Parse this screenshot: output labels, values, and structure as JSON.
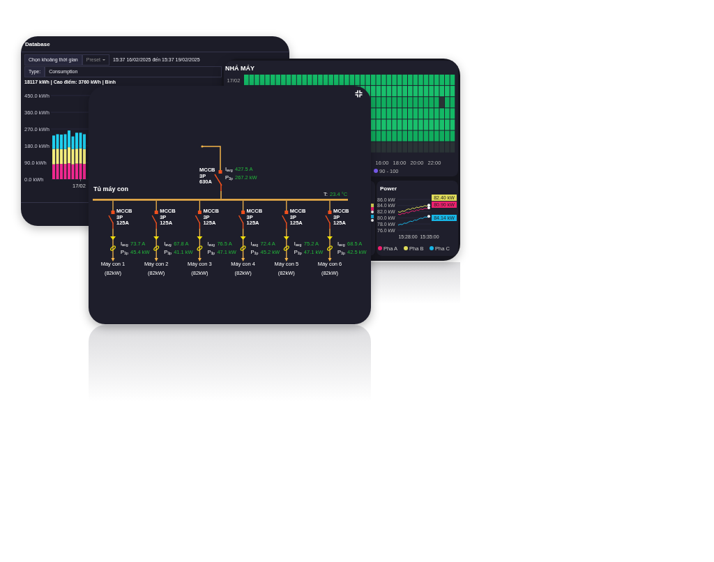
{
  "database": {
    "title": "Database",
    "range_label": "Chọn khoảng thời gian",
    "preset": "Preset",
    "range": "15:37 16/02/2025 đến 15:37 19/02/2025",
    "type_label": "Type:",
    "type_value": "Consumption",
    "summary": "18117 kWh | Cao điểm: 3760 kWh | Bình",
    "date_label": "17/02",
    "chart_data": {
      "type": "bar",
      "stacked": true,
      "grid": true,
      "ylim": [
        0,
        450
      ],
      "yticks": [
        {
          "value": 450,
          "label": "450.0 kWh"
        },
        {
          "value": 360,
          "label": "360.0 kWh"
        },
        {
          "value": 270,
          "label": "270.0 kWh"
        },
        {
          "value": 180,
          "label": "180.0 kWh"
        },
        {
          "value": 90,
          "label": "90.0 kWh"
        },
        {
          "value": 0,
          "label": "0.0 kWh"
        }
      ],
      "series": [
        {
          "color": "#f0288f",
          "values": [
            80,
            82,
            82,
            82,
            86,
            80,
            84,
            84,
            82
          ]
        },
        {
          "color": "#f2ec7c",
          "values": [
            83,
            82,
            80,
            80,
            86,
            82,
            80,
            82,
            80
          ]
        },
        {
          "color": "#1fd0ef",
          "values": [
            72,
            78,
            78,
            80,
            90,
            68,
            86,
            84,
            80
          ]
        }
      ]
    }
  },
  "factory": {
    "title": "NHÁ MÁY",
    "row_label": "17/02",
    "xlabels": [
      "16:00",
      "18:00",
      "20:00",
      "22:00"
    ],
    "legend": [
      {
        "label": "90 - 100",
        "color": "#7a5cf0"
      }
    ]
  },
  "power": {
    "title": "Power",
    "x_labels": [
      "15:28:00",
      "15:35:00"
    ],
    "value_tags": [
      {
        "text": "82.40 kW",
        "color": "#e0dc5a"
      },
      {
        "text": "80.90 kW",
        "color": "#f0206f"
      },
      {
        "text": "84.14 kW",
        "color": "#18b6e6"
      }
    ],
    "chart_data": {
      "type": "line",
      "grid": true,
      "legend": "bottom",
      "ylim": [
        76,
        86
      ],
      "yticks": [
        {
          "value": 86,
          "label": "86.0 kW"
        },
        {
          "value": 84,
          "label": "84.0 kW"
        },
        {
          "value": 82,
          "label": "82.0 kW"
        },
        {
          "value": 80,
          "label": "80.0 kW"
        },
        {
          "value": 78,
          "label": "78.0 kW"
        },
        {
          "value": 76,
          "label": "76.0 kW"
        }
      ],
      "series": [
        {
          "name": "Pha A",
          "color": "#f0206f",
          "values": [
            81.2,
            81.0,
            81.5,
            81.3,
            81.8,
            81.6,
            82.0,
            82.3,
            82.1,
            82.6,
            82.4,
            82.9,
            82.7,
            83.1,
            83.0,
            83.3
          ]
        },
        {
          "name": "Pha B",
          "color": "#e0dc5a",
          "values": [
            82.0,
            81.8,
            82.3,
            82.1,
            82.6,
            82.9,
            82.7,
            83.2,
            83.0,
            83.5,
            83.3,
            83.7,
            83.6,
            84.0,
            83.8,
            84.1
          ]
        },
        {
          "name": "Pha C",
          "color": "#18b6e6",
          "values": [
            77.6,
            77.9,
            77.8,
            78.3,
            78.2,
            78.6,
            78.9,
            78.8,
            79.3,
            79.2,
            79.6,
            79.9,
            79.8,
            80.3,
            80.2,
            80.5
          ]
        }
      ]
    }
  },
  "diagram": {
    "title": "Tủ máy con",
    "temperature_label": "T:",
    "temperature": "23.4 °C",
    "main": {
      "breaker": "MCCB\n3P\n630A",
      "current_label": "I$_{avg}$",
      "current": "427.5 A",
      "power_label": "P$_{3p}$",
      "power": "267.2 kW"
    },
    "feeders": [
      {
        "breaker": "MCCB\n3P\n125A",
        "current_label": "I$_{avg}$",
        "current": "73.7 A",
        "power_label": "P$_{3p}$",
        "power": "45.4 kW",
        "name": "Máy con 1",
        "rating": "(82kW)"
      },
      {
        "breaker": "MCCB\n3P\n125A",
        "current_label": "I$_{avg}$",
        "current": "67.8 A",
        "power_label": "P$_{3p}$",
        "power": "41.1 kW",
        "name": "Máy con 2",
        "rating": "(82kW)"
      },
      {
        "breaker": "MCCB\n3P\n125A",
        "current_label": "I$_{avg}$",
        "current": "76.5 A",
        "power_label": "P$_{3p}$",
        "power": "47.1 kW",
        "name": "Máy con 3",
        "rating": "(82kW)"
      },
      {
        "breaker": "MCCB\n3P\n125A",
        "current_label": "I$_{avg}$",
        "current": "72.4 A",
        "power_label": "P$_{3p}$",
        "power": "45.2 kW",
        "name": "Máy con 4",
        "rating": "(82kW)"
      },
      {
        "breaker": "MCCB\n3P\n125A",
        "current_label": "I$_{avg}$",
        "current": "75.2 A",
        "power_label": "P$_{3p}$",
        "power": "47.1 kW",
        "name": "Máy con 5",
        "rating": "(82kW)"
      },
      {
        "breaker": "MCCB\n3P\n125A",
        "current_label": "I$_{avg}$",
        "current": "68.5 A",
        "power_label": "P$_{3p}$",
        "power": "42.5 kW",
        "name": "Máy con 6",
        "rating": "(82kW)"
      }
    ]
  }
}
